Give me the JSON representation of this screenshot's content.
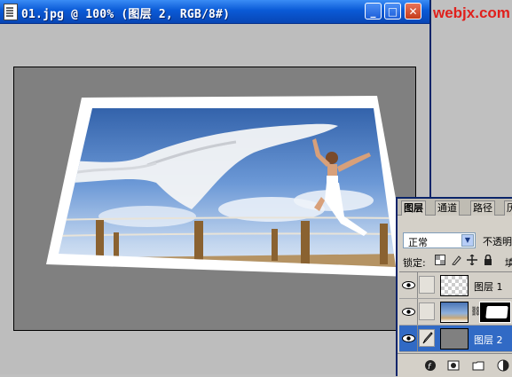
{
  "window": {
    "title": "01.jpg @ 100% (图层 2, RGB/8#)",
    "minimize_glyph": "_",
    "maximize_glyph": "□",
    "close_glyph": "✕"
  },
  "watermark": "webjx.com",
  "layers_panel": {
    "tabs": [
      "图层",
      "通道",
      "路径",
      "历"
    ],
    "blend_mode": "正常",
    "opacity_label": "不透明",
    "lock_label": "锁定:",
    "fill_label": "填",
    "layers": [
      {
        "name": "图层 1",
        "visible": true,
        "selected": false,
        "thumbnail": "transparent"
      },
      {
        "name": "",
        "visible": true,
        "selected": false,
        "thumbnail": "photo-with-mask"
      },
      {
        "name": "图层 2",
        "visible": true,
        "selected": true,
        "thumbnail": "gray"
      }
    ],
    "footer_icons": [
      "layer-style-icon",
      "add-mask-icon",
      "new-set-icon",
      "adjustment-icon"
    ]
  },
  "colors": {
    "titlebar": "#0a5ad6",
    "canvas_bg": "#808080",
    "selected_layer": "#316ac5",
    "watermark": "#e0201c"
  }
}
